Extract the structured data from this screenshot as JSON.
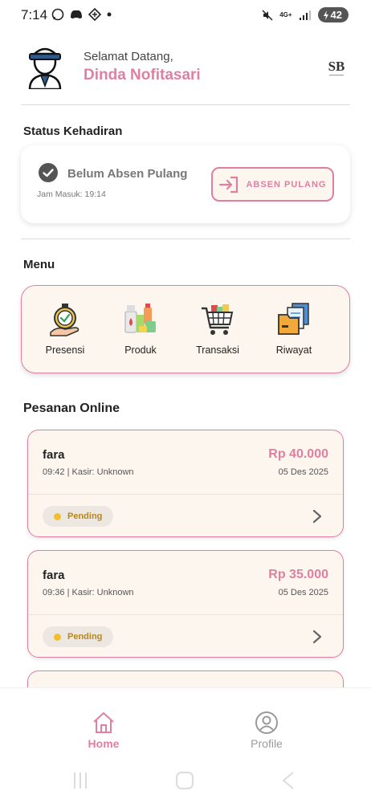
{
  "status_bar": {
    "time": "7:14",
    "network": "4G+",
    "battery": "42",
    "icons": [
      "whatsapp-icon",
      "discord-icon",
      "app-icon",
      "dot-icon",
      "mute-icon",
      "signal-icon",
      "battery-icon"
    ]
  },
  "header": {
    "greeting": "Selamat Datang,",
    "user_name": "Dinda Nofitasari",
    "logo_text": "SB"
  },
  "status_section": {
    "title": "Status Kehadiran",
    "status": "Belum Absen Pulang",
    "check_in_time": "Jam Masuk: 19:14",
    "button_label": "ABSEN PULANG"
  },
  "menu_section": {
    "title": "Menu",
    "items": [
      {
        "label": "Presensi",
        "icon": "stopwatch-icon"
      },
      {
        "label": "Produk",
        "icon": "products-icon"
      },
      {
        "label": "Transaksi",
        "icon": "cart-icon"
      },
      {
        "label": "Riwayat",
        "icon": "folder-icon"
      }
    ]
  },
  "orders_section": {
    "title": "Pesanan Online",
    "orders": [
      {
        "customer": "fara",
        "meta": "09:42 | Kasir: Unknown",
        "price": "Rp 40.000",
        "date": "05 Des 2025",
        "status": "Pending"
      },
      {
        "customer": "fara",
        "meta": "09:36 | Kasir: Unknown",
        "price": "Rp 35.000",
        "date": "05 Des 2025",
        "status": "Pending"
      }
    ]
  },
  "bottom_nav": {
    "items": [
      {
        "label": "Home",
        "icon": "home-icon",
        "active": true
      },
      {
        "label": "Profile",
        "icon": "profile-icon",
        "active": false
      }
    ]
  },
  "colors": {
    "accent": "#e07fa0",
    "card_bg": "#fdf6ee",
    "pending": "#f2c02e",
    "inactive": "#9a9a9a"
  }
}
